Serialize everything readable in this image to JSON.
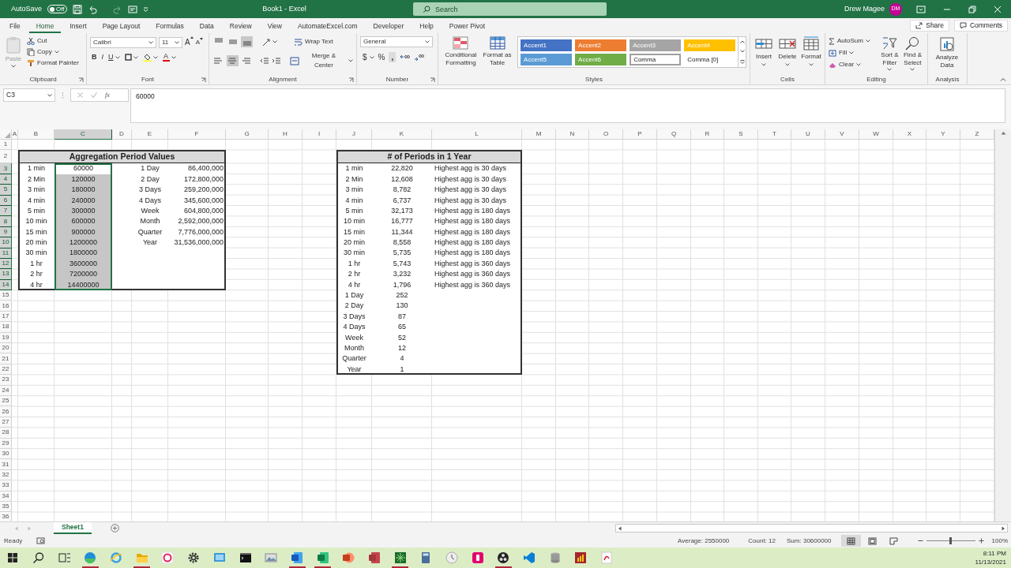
{
  "title_bar": {
    "autosave_label": "AutoSave",
    "autosave_on": false,
    "autosave_state": "Off",
    "title": "Book1 - Excel",
    "search_placeholder": "Search",
    "user_name": "Drew Magee",
    "user_initials": "DM"
  },
  "ribbon_tabs": [
    {
      "label": "File",
      "selected": false
    },
    {
      "label": "Home",
      "selected": true
    },
    {
      "label": "Insert",
      "selected": false
    },
    {
      "label": "Page Layout",
      "selected": false
    },
    {
      "label": "Formulas",
      "selected": false
    },
    {
      "label": "Data",
      "selected": false
    },
    {
      "label": "Review",
      "selected": false
    },
    {
      "label": "View",
      "selected": false
    },
    {
      "label": "AutomateExcel.com",
      "selected": false
    },
    {
      "label": "Developer",
      "selected": false
    },
    {
      "label": "Help",
      "selected": false
    },
    {
      "label": "Power Pivot",
      "selected": false
    }
  ],
  "share_button": "Share",
  "comments_button": "Comments",
  "clipboard": {
    "paste": "Paste",
    "cut": "Cut",
    "copy": "Copy",
    "format_painter": "Format Painter",
    "label": "Clipboard"
  },
  "font": {
    "name": "Calibri",
    "size": "11",
    "grow": "A",
    "shrink": "A",
    "bold": "B",
    "italic": "I",
    "underline": "U",
    "font_color": "A",
    "label": "Font"
  },
  "alignment": {
    "vertical": [
      {
        "selected": false
      },
      {
        "selected": false
      },
      {
        "selected": true
      }
    ],
    "horizontal": [
      {
        "selected": false
      },
      {
        "selected": true
      },
      {
        "selected": false
      }
    ],
    "wrap_text": "Wrap Text",
    "merge": "Merge & Center",
    "label": "Alignment"
  },
  "number": {
    "format": "General",
    "currency": "$",
    "percent": "%",
    "comma": ",",
    "label": "Number"
  },
  "styles": {
    "conditional_formatting": "Conditional Formatting",
    "format_as_table": "Format as Table",
    "label": "Styles",
    "cell_styles": [
      {
        "label": "Accent1",
        "kind": "filled",
        "color": "#4472c4",
        "selected": false
      },
      {
        "label": "Accent2",
        "kind": "filled",
        "color": "#ed7d31",
        "selected": false
      },
      {
        "label": "Accent3",
        "kind": "filled",
        "color": "#a5a5a5",
        "selected": false
      },
      {
        "label": "Accent4",
        "kind": "filled",
        "color": "#ffc000",
        "selected": false
      },
      {
        "label": "Accent5",
        "kind": "filled",
        "color": "#5b9bd5",
        "selected": false
      },
      {
        "label": "Accent6",
        "kind": "filled",
        "color": "#70ad47",
        "selected": false
      },
      {
        "label": "Comma",
        "kind": "plain",
        "selected": true
      },
      {
        "label": "Comma [0]",
        "kind": "plain",
        "selected": false
      }
    ]
  },
  "cells": {
    "buttons": [
      "Insert",
      "Delete",
      "Format"
    ],
    "label": "Cells"
  },
  "editing": {
    "autosum": "AutoSum",
    "fill": "Fill",
    "clear": "Clear",
    "sort_filter": "Sort & Filter",
    "find_select": "Find & Select",
    "label": "Editing"
  },
  "analysis": {
    "analyze_data": "Analyze Data",
    "label": "Analysis"
  },
  "formula_bar": {
    "name_box": "C3",
    "function_label": "fx",
    "formula": "60000"
  },
  "sheet": {
    "columns": [
      {
        "label": "A",
        "selected": false
      },
      {
        "label": "B",
        "selected": false
      },
      {
        "label": "C",
        "selected": true
      },
      {
        "label": "D",
        "selected": false
      },
      {
        "label": "E",
        "selected": false
      },
      {
        "label": "F",
        "selected": false
      },
      {
        "label": "G",
        "selected": false
      },
      {
        "label": "H",
        "selected": false
      },
      {
        "label": "I",
        "selected": false
      },
      {
        "label": "J",
        "selected": false
      },
      {
        "label": "K",
        "selected": false
      },
      {
        "label": "L",
        "selected": false
      },
      {
        "label": "M",
        "selected": false
      },
      {
        "label": "N",
        "selected": false
      },
      {
        "label": "O",
        "selected": false
      },
      {
        "label": "P",
        "selected": false
      },
      {
        "label": "Q",
        "selected": false
      },
      {
        "label": "R",
        "selected": false
      },
      {
        "label": "S",
        "selected": false
      },
      {
        "label": "T",
        "selected": false
      },
      {
        "label": "U",
        "selected": false
      },
      {
        "label": "V",
        "selected": false
      },
      {
        "label": "W",
        "selected": false
      },
      {
        "label": "X",
        "selected": false
      },
      {
        "label": "Y",
        "selected": false
      },
      {
        "label": "Z",
        "selected": false
      }
    ],
    "rows": [
      {
        "label": "1",
        "selected": false
      },
      {
        "label": "2",
        "selected": false
      },
      {
        "label": "3",
        "selected": true
      },
      {
        "label": "4",
        "selected": true
      },
      {
        "label": "5",
        "selected": true
      },
      {
        "label": "6",
        "selected": true
      },
      {
        "label": "7",
        "selected": true
      },
      {
        "label": "8",
        "selected": true
      },
      {
        "label": "9",
        "selected": true
      },
      {
        "label": "10",
        "selected": true
      },
      {
        "label": "11",
        "selected": true
      },
      {
        "label": "12",
        "selected": true
      },
      {
        "label": "13",
        "selected": true
      },
      {
        "label": "14",
        "selected": true
      },
      {
        "label": "15",
        "selected": false
      },
      {
        "label": "16",
        "selected": false
      },
      {
        "label": "17",
        "selected": false
      },
      {
        "label": "18",
        "selected": false
      },
      {
        "label": "19",
        "selected": false
      },
      {
        "label": "20",
        "selected": false
      },
      {
        "label": "21",
        "selected": false
      },
      {
        "label": "22",
        "selected": false
      },
      {
        "label": "23",
        "selected": false
      },
      {
        "label": "24",
        "selected": false
      },
      {
        "label": "25",
        "selected": false
      },
      {
        "label": "26",
        "selected": false
      },
      {
        "label": "27",
        "selected": false
      },
      {
        "label": "28",
        "selected": false
      },
      {
        "label": "29",
        "selected": false
      },
      {
        "label": "30",
        "selected": false
      },
      {
        "label": "31",
        "selected": false
      },
      {
        "label": "32",
        "selected": false
      },
      {
        "label": "33",
        "selected": false
      },
      {
        "label": "34",
        "selected": false
      },
      {
        "label": "35",
        "selected": false
      },
      {
        "label": "36",
        "selected": false
      }
    ]
  },
  "aggregation_table": {
    "title": "Aggregation Period Values",
    "minute_rows": [
      {
        "label": "1 min",
        "value": "60000",
        "selected": true,
        "active": true
      },
      {
        "label": "2 Min",
        "value": "120000",
        "selected": true,
        "active": false
      },
      {
        "label": "3 min",
        "value": "180000",
        "selected": true,
        "active": false
      },
      {
        "label": "4 min",
        "value": "240000",
        "selected": true,
        "active": false
      },
      {
        "label": "5 min",
        "value": "300000",
        "selected": true,
        "active": false
      },
      {
        "label": "10 min",
        "value": "600000",
        "selected": true,
        "active": false
      },
      {
        "label": "15 min",
        "value": "900000",
        "selected": true,
        "active": false
      },
      {
        "label": "20 min",
        "value": "1200000",
        "selected": true,
        "active": false
      },
      {
        "label": "30 min",
        "value": "1800000",
        "selected": true,
        "active": false
      },
      {
        "label": "1 hr",
        "value": "3600000",
        "selected": true,
        "active": false
      },
      {
        "label": "2 hr",
        "value": "7200000",
        "selected": true,
        "active": false
      },
      {
        "label": "4 hr",
        "value": "14400000",
        "selected": true,
        "active": false
      }
    ],
    "day_rows": [
      {
        "label": "1 Day",
        "value": "86,400,000"
      },
      {
        "label": "2 Day",
        "value": "172,800,000"
      },
      {
        "label": "3 Days",
        "value": "259,200,000"
      },
      {
        "label": "4 Days",
        "value": "345,600,000"
      },
      {
        "label": "Week",
        "value": "604,800,000"
      },
      {
        "label": "Month",
        "value": "2,592,000,000"
      },
      {
        "label": "Quarter",
        "value": "7,776,000,000"
      },
      {
        "label": "Year",
        "value": "31,536,000,000"
      }
    ]
  },
  "periods_table": {
    "title": "# of Periods in 1 Year",
    "rows": [
      {
        "label": "1 min",
        "count": "22,820",
        "note": "Highest agg is 30 days"
      },
      {
        "label": "2 Min",
        "count": "12,608",
        "note": "Highest agg is 30 days"
      },
      {
        "label": "3 min",
        "count": "8,782",
        "note": "Highest agg is 30 days"
      },
      {
        "label": "4 min",
        "count": "6,737",
        "note": "Highest agg is 30 days"
      },
      {
        "label": "5 min",
        "count": "32,173",
        "note": "Highest agg is 180 days"
      },
      {
        "label": "10 min",
        "count": "16,777",
        "note": "Highest agg is 180 days"
      },
      {
        "label": "15 min",
        "count": "11,344",
        "note": "Highest agg is 180 days"
      },
      {
        "label": "20 min",
        "count": "8,558",
        "note": "Highest agg is 180 days"
      },
      {
        "label": "30 min",
        "count": "5,735",
        "note": "Highest agg is 180 days"
      },
      {
        "label": "1 hr",
        "count": "5,743",
        "note": "Highest agg is 360 days"
      },
      {
        "label": "2 hr",
        "count": "3,232",
        "note": "Highest agg is 360 days"
      },
      {
        "label": "4 hr",
        "count": "1,796",
        "note": "Highest agg is 360 days"
      },
      {
        "label": "1 Day",
        "count": "252"
      },
      {
        "label": "2 Day",
        "count": "130"
      },
      {
        "label": "3 Days",
        "count": "87"
      },
      {
        "label": "4 Days",
        "count": "65"
      },
      {
        "label": "Week",
        "count": "52"
      },
      {
        "label": "Month",
        "count": "12"
      },
      {
        "label": "Quarter",
        "count": "4"
      },
      {
        "label": "Year",
        "count": "1"
      }
    ]
  },
  "sheet_tabs": [
    {
      "label": "Sheet1",
      "selected": true
    }
  ],
  "status_bar": {
    "mode": "Ready",
    "average": "Average: 2550000",
    "count": "Count: 12",
    "sum": "Sum: 30600000",
    "views": [
      {
        "kind": "normal",
        "selected": true
      },
      {
        "kind": "page_layout",
        "selected": false
      },
      {
        "kind": "page_break",
        "selected": false
      }
    ],
    "zoom": {
      "level": 0.5,
      "reading": "100%"
    }
  },
  "taskbar": {
    "apps": [
      {
        "kind": "start",
        "running": false
      },
      {
        "kind": "search",
        "running": false
      },
      {
        "kind": "taskview",
        "running": false
      },
      {
        "kind": "edge",
        "running": true
      },
      {
        "kind": "ie",
        "running": false
      },
      {
        "kind": "folder",
        "running": true
      },
      {
        "kind": "sync",
        "running": false
      },
      {
        "kind": "gear",
        "running": false
      },
      {
        "kind": "remote",
        "running": false
      },
      {
        "kind": "terminal",
        "running": false
      },
      {
        "kind": "photos",
        "running": false
      },
      {
        "kind": "word",
        "running": true
      },
      {
        "kind": "excel",
        "running": true
      },
      {
        "kind": "powerpoint",
        "running": false
      },
      {
        "kind": "access",
        "running": false
      },
      {
        "kind": "network",
        "running": true
      },
      {
        "kind": "calculator",
        "running": false
      },
      {
        "kind": "clock",
        "running": false
      },
      {
        "kind": "pink",
        "running": false
      },
      {
        "kind": "obs",
        "running": true
      },
      {
        "kind": "vscode",
        "running": false
      },
      {
        "kind": "database",
        "running": false
      },
      {
        "kind": "powerbi",
        "running": false
      },
      {
        "kind": "pdf",
        "running": false
      }
    ],
    "time": "8:11 PM",
    "date": "11/13/2021"
  }
}
